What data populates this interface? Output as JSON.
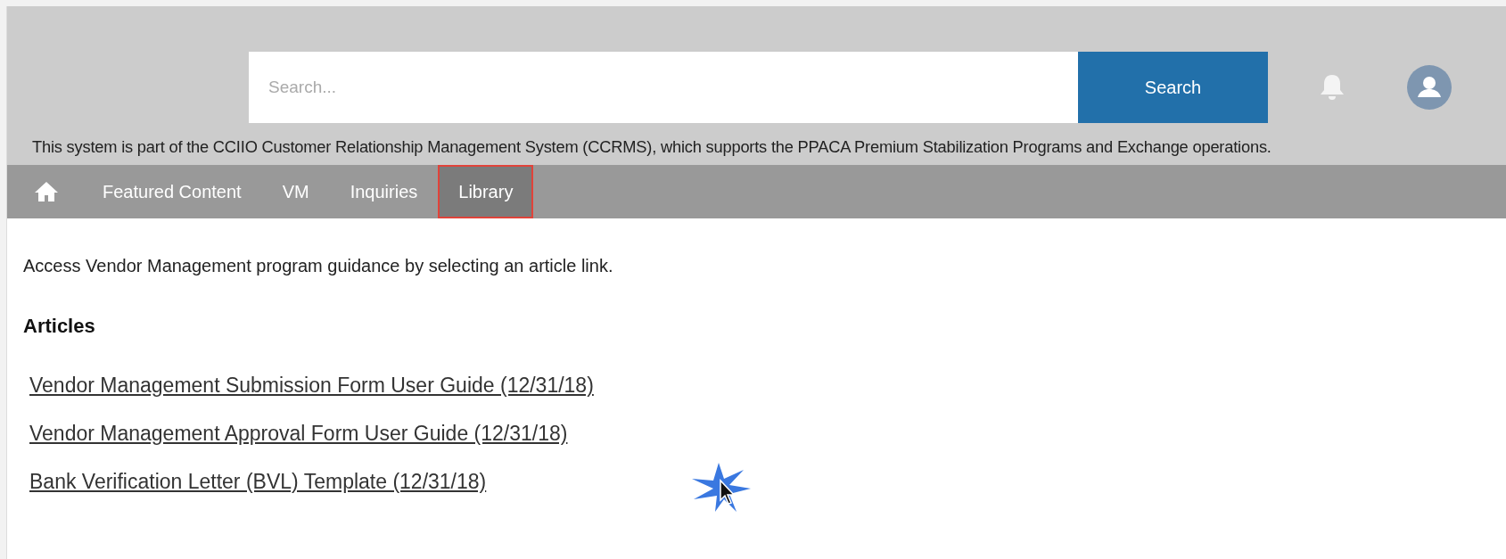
{
  "header": {
    "search": {
      "placeholder": "Search..."
    },
    "search_button": "Search",
    "notice": "This system is part of the CCIIO Customer Relationship Management System (CCRMS), which supports the PPACA Premium Stabilization Programs and Exchange operations."
  },
  "nav": {
    "items": [
      {
        "label": "Featured Content",
        "selected": false
      },
      {
        "label": "VM",
        "selected": false
      },
      {
        "label": "Inquiries",
        "selected": false
      },
      {
        "label": "Library",
        "selected": true
      }
    ]
  },
  "intro": "Access Vendor Management program guidance by selecting an article link.",
  "articles": {
    "heading": "Articles",
    "links": [
      "Vendor Management Submission Form User Guide (12/31/18)",
      "Vendor Management Approval Form User Guide (12/31/18)",
      "Bank Verification Letter (BVL) Template (12/31/18)"
    ]
  }
}
